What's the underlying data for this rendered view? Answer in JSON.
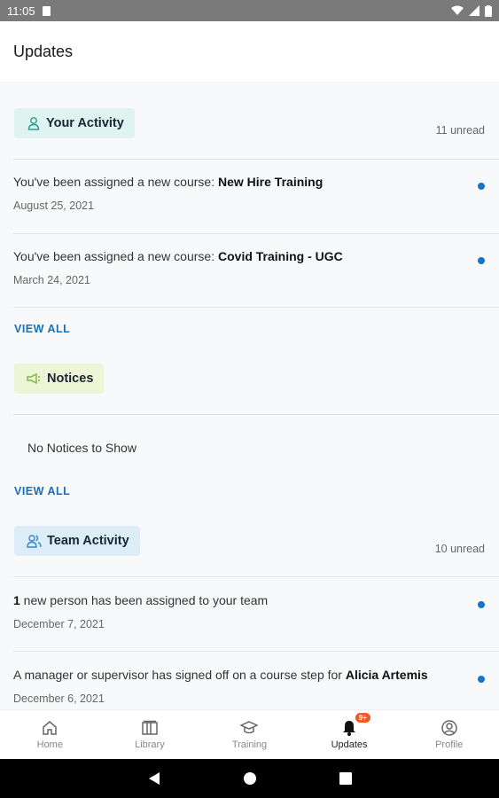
{
  "status_bar": {
    "time": "11:05"
  },
  "app_bar": {
    "title": "Updates"
  },
  "your_activity": {
    "title": "Your Activity",
    "unread": "11 unread",
    "items": [
      {
        "text": "You've been assigned a new course: ",
        "bold": "New Hire Training",
        "date": "August 25, 2021"
      },
      {
        "text": "You've been assigned a new course: ",
        "bold": "Covid Training - UGC",
        "date": "March 24, 2021"
      }
    ],
    "view_all": "VIEW ALL"
  },
  "notices": {
    "title": "Notices",
    "empty": "No Notices to Show",
    "view_all": "VIEW ALL"
  },
  "team_activity": {
    "title": "Team Activity",
    "unread": "10 unread",
    "items": [
      {
        "bold": "1",
        "text": " new person has been assigned to your team",
        "date": "December 7, 2021"
      },
      {
        "text": "A manager or supervisor has signed off on a course step for ",
        "bold": "Alicia Artemis",
        "date": "December 6, 2021"
      }
    ]
  },
  "bottom_nav": {
    "items": [
      {
        "label": "Home",
        "icon": "home-icon"
      },
      {
        "label": "Library",
        "icon": "library-icon"
      },
      {
        "label": "Training",
        "icon": "graduation-cap-icon"
      },
      {
        "label": "Updates",
        "icon": "bell-icon",
        "badge": "9+"
      },
      {
        "label": "Profile",
        "icon": "profile-icon"
      }
    ],
    "active": "Updates"
  },
  "colors": {
    "accent": "#1a6fb5",
    "badge": "#f05a28",
    "unread_dot": "#1a73c8"
  }
}
